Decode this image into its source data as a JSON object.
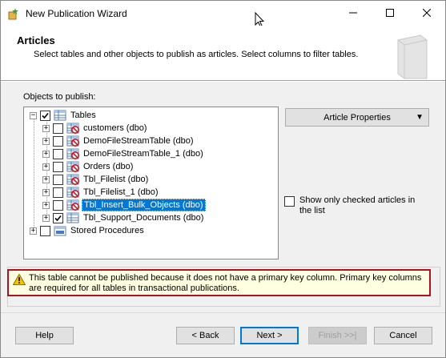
{
  "window": {
    "title": "New Publication Wizard",
    "controls": [
      "minimize-icon",
      "maximize-icon",
      "close-icon"
    ]
  },
  "header": {
    "title": "Articles",
    "description": "Select tables and other objects to publish as articles. Select columns to filter tables."
  },
  "objects_label": "Objects to publish:",
  "tree": {
    "tables_label": "Tables",
    "items": [
      {
        "label": "customers (dbo)",
        "checked": false,
        "icon": "table-not-publishable-icon"
      },
      {
        "label": "DemoFileStreamTable (dbo)",
        "checked": false,
        "icon": "table-not-publishable-icon"
      },
      {
        "label": "DemoFileStreamTable_1 (dbo)",
        "checked": false,
        "icon": "table-not-publishable-icon"
      },
      {
        "label": "Orders (dbo)",
        "checked": false,
        "icon": "table-not-publishable-icon"
      },
      {
        "label": "Tbl_Filelist (dbo)",
        "checked": false,
        "icon": "table-not-publishable-icon"
      },
      {
        "label": "Tbl_Filelist_1 (dbo)",
        "checked": false,
        "icon": "table-not-publishable-icon"
      },
      {
        "label": "Tbl_Insert_Bulk_Objects (dbo)",
        "checked": false,
        "icon": "table-not-publishable-icon",
        "selected": true
      },
      {
        "label": "Tbl_Support_Documents (dbo)",
        "checked": true,
        "icon": "table-icon"
      }
    ],
    "stored_procedures_label": "Stored Procedures"
  },
  "article_properties_label": "Article Properties",
  "show_only_checked_label": "Show only checked articles in the list",
  "warning_text": "This table cannot be published because it does not have a primary key column. Primary key columns are required for all tables in transactional publications.",
  "buttons": {
    "help": "Help",
    "back": "< Back",
    "next": "Next >",
    "finish": "Finish >>|",
    "cancel": "Cancel"
  },
  "colors": {
    "selection": "#0078d7",
    "warning_border": "#b01020",
    "warning_bg": "#ffffe1"
  }
}
